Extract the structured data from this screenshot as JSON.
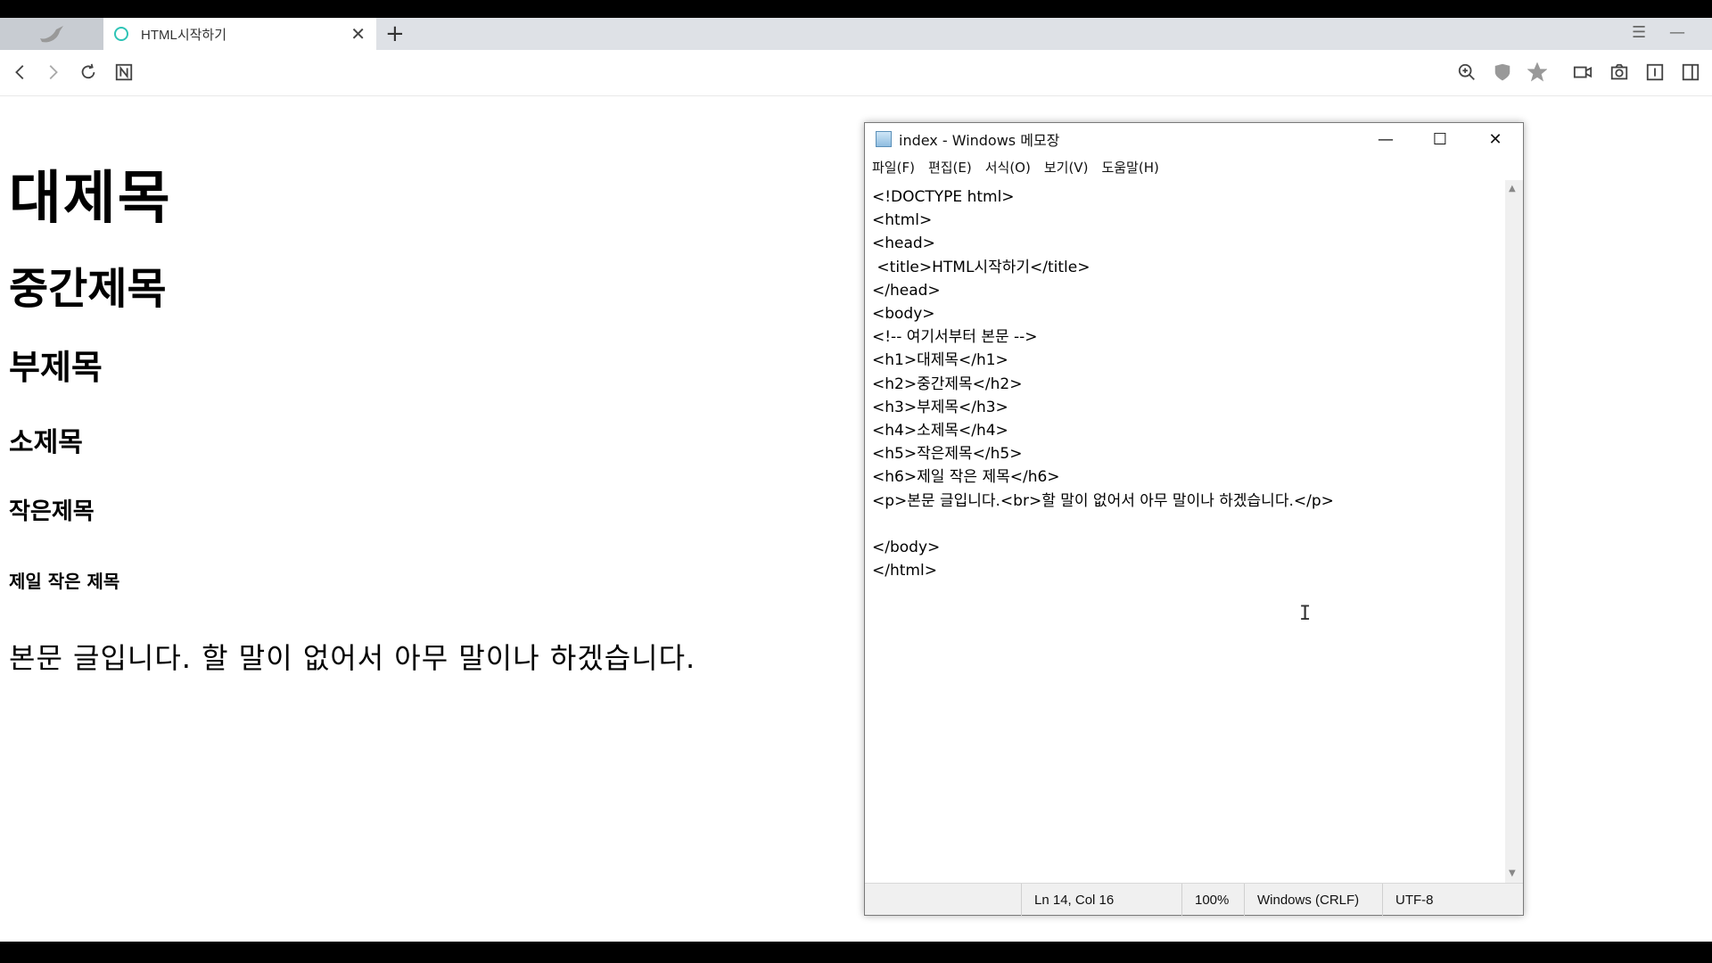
{
  "browser": {
    "tab_title": "HTML시작하기",
    "tab_close": "✕",
    "new_tab": "+"
  },
  "page": {
    "h1": "대제목",
    "h2": "중간제목",
    "h3": "부제목",
    "h4": "소제목",
    "h5": "작은제목",
    "h6": "제일 작은 제목",
    "p": "본문 글입니다. 할 말이 없어서 아무 말이나 하겠습니다."
  },
  "notepad": {
    "title": "index - Windows 메모장",
    "menu": [
      "파일(F)",
      "편집(E)",
      "서식(O)",
      "보기(V)",
      "도움말(H)"
    ],
    "content": "<!DOCTYPE html>\n<html>\n<head>\n <title>HTML시작하기</title>\n</head>\n<body>\n<!-- 여기서부터 본문 -->\n<h1>대제목</h1>\n<h2>중간제목</h2>\n<h3>부제목</h3>\n<h4>소제목</h4>\n<h5>작은제목</h5>\n<h6>제일 작은 제목</h6>\n<p>본문 글입니다.<br>할 말이 없어서 아무 말이나 하겠습니다.</p>\n\n</body>\n</html>",
    "status": {
      "position": "Ln 14, Col 16",
      "zoom": "100%",
      "line_ending": "Windows (CRLF)",
      "encoding": "UTF-8"
    }
  }
}
